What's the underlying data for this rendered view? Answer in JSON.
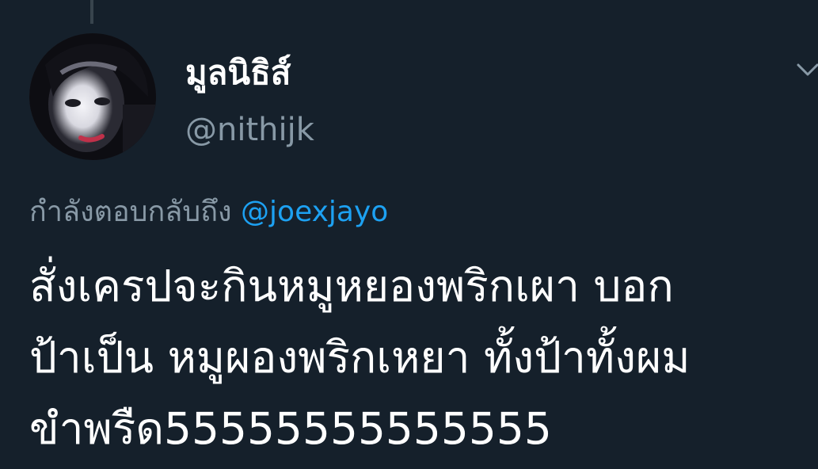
{
  "tweet": {
    "display_name": "มูลนิธิส์",
    "handle": "@nithijk",
    "reply_prefix": "กำลังตอบกลับถึง",
    "reply_mention": "@joexjayo",
    "body_lines": [
      "สั่งเครปจะกินหมูหยองพริกเผา บอก",
      "ป้าเป็น หมูผองพริกเหยา ทั้งป้าทั้งผม",
      "ขำพรืด55555555555555"
    ]
  },
  "icons": {
    "avatar": "profile-photo",
    "menu": "chevron-down-icon"
  },
  "colors": {
    "background": "#15202b",
    "secondary_text": "#8899a6",
    "link": "#1da1f2",
    "primary_text": "#ffffff"
  }
}
